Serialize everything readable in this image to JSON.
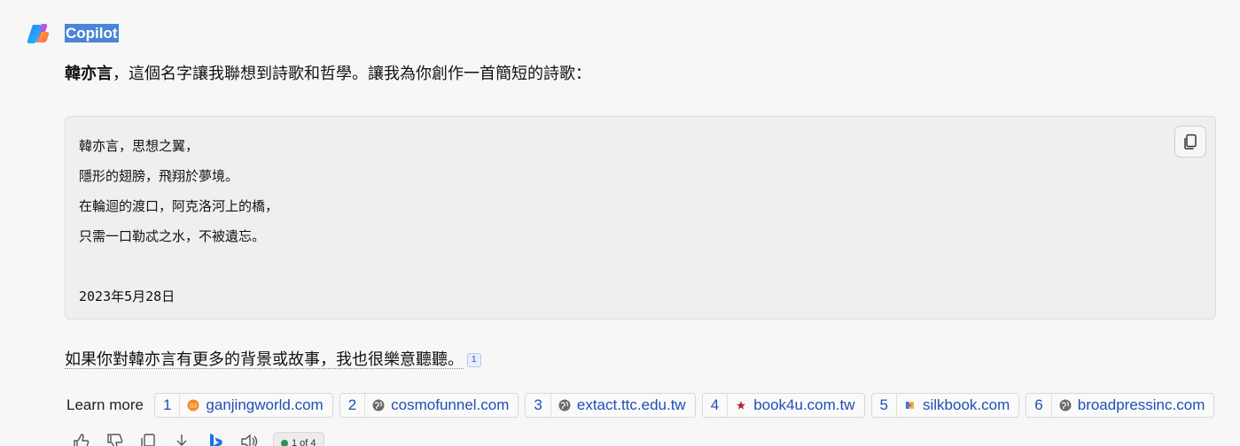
{
  "header": {
    "sender": "Copilot"
  },
  "message": {
    "intro_bold": "韓亦言",
    "intro_rest": "，這個名字讓我聯想到詩歌和哲學。讓我為你創作一首簡短的詩歌：",
    "code_lines": [
      "韓亦言，思想之翼，",
      "隱形的翅膀，飛翔於夢境。",
      "在輪迴的渡口，阿克洛河上的橋，",
      "只需一口勒忒之水，不被遺忘。",
      "",
      "2023年5月28日"
    ],
    "followup": "如果你對韓亦言有更多的背景或故事，我也很樂意聽聽。",
    "followup_citation": "1"
  },
  "learn_more": {
    "label": "Learn more",
    "sources": [
      {
        "num": "1",
        "domain": "ganjingworld.com",
        "favicon": "ganjing-favicon",
        "color": "#f28c28"
      },
      {
        "num": "2",
        "domain": "cosmofunnel.com",
        "favicon": "globe-icon",
        "color": "#666666"
      },
      {
        "num": "3",
        "domain": "extact.ttc.edu.tw",
        "favicon": "globe-icon",
        "color": "#666666"
      },
      {
        "num": "4",
        "domain": "book4u.com.tw",
        "favicon": "star-favicon",
        "color": "#b22234"
      },
      {
        "num": "5",
        "domain": "silkbook.com",
        "favicon": "silkbook-favicon",
        "color": "#3a7bd5"
      },
      {
        "num": "6",
        "domain": "broadpressinc.com",
        "favicon": "globe-icon",
        "color": "#666666"
      }
    ]
  },
  "actions": {
    "pager": "1 of 4"
  }
}
